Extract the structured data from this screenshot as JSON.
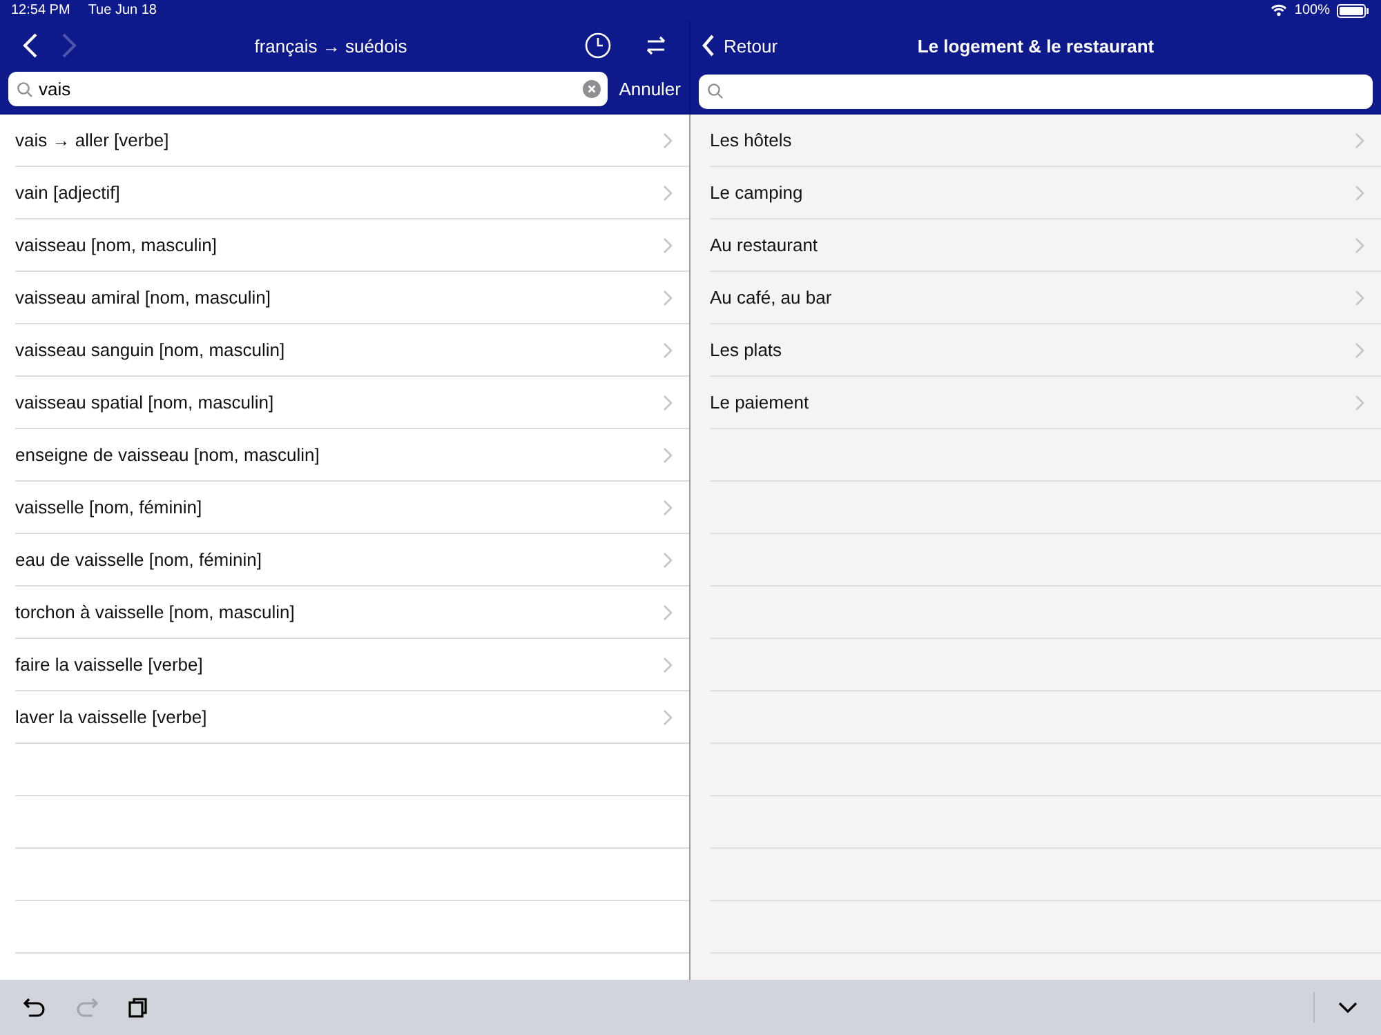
{
  "status_bar": {
    "time": "12:54 PM",
    "date": "Tue Jun 18",
    "battery": "100%"
  },
  "left": {
    "title": "français → suédois",
    "nav": [
      {
        "kind": "back",
        "disabled": false
      },
      {
        "kind": "forward",
        "disabled": true
      }
    ],
    "search": {
      "value": "vais",
      "cancel": "Annuler"
    },
    "results": [
      "vais → aller [verbe]",
      "vain [adjectif]",
      "vaisseau [nom, masculin]",
      "vaisseau amiral [nom, masculin]",
      "vaisseau sanguin [nom, masculin]",
      "vaisseau spatial [nom, masculin]",
      "enseigne de vaisseau [nom, masculin]",
      "vaisselle [nom, féminin]",
      "eau de vaisselle [nom, féminin]",
      "torchon à vaisselle [nom, masculin]",
      "faire la vaisselle [verbe]",
      "laver la vaisselle [verbe]"
    ]
  },
  "right": {
    "back": "Retour",
    "title": "Le logement & le restaurant",
    "items": [
      "Les hôtels",
      "Le camping",
      "Au restaurant",
      "Au café, au bar",
      "Les plats",
      "Le paiement"
    ]
  },
  "toolbar": [
    {
      "kind": "undo",
      "disabled": false
    },
    {
      "kind": "redo",
      "disabled": true
    },
    {
      "kind": "copy",
      "disabled": false
    }
  ]
}
